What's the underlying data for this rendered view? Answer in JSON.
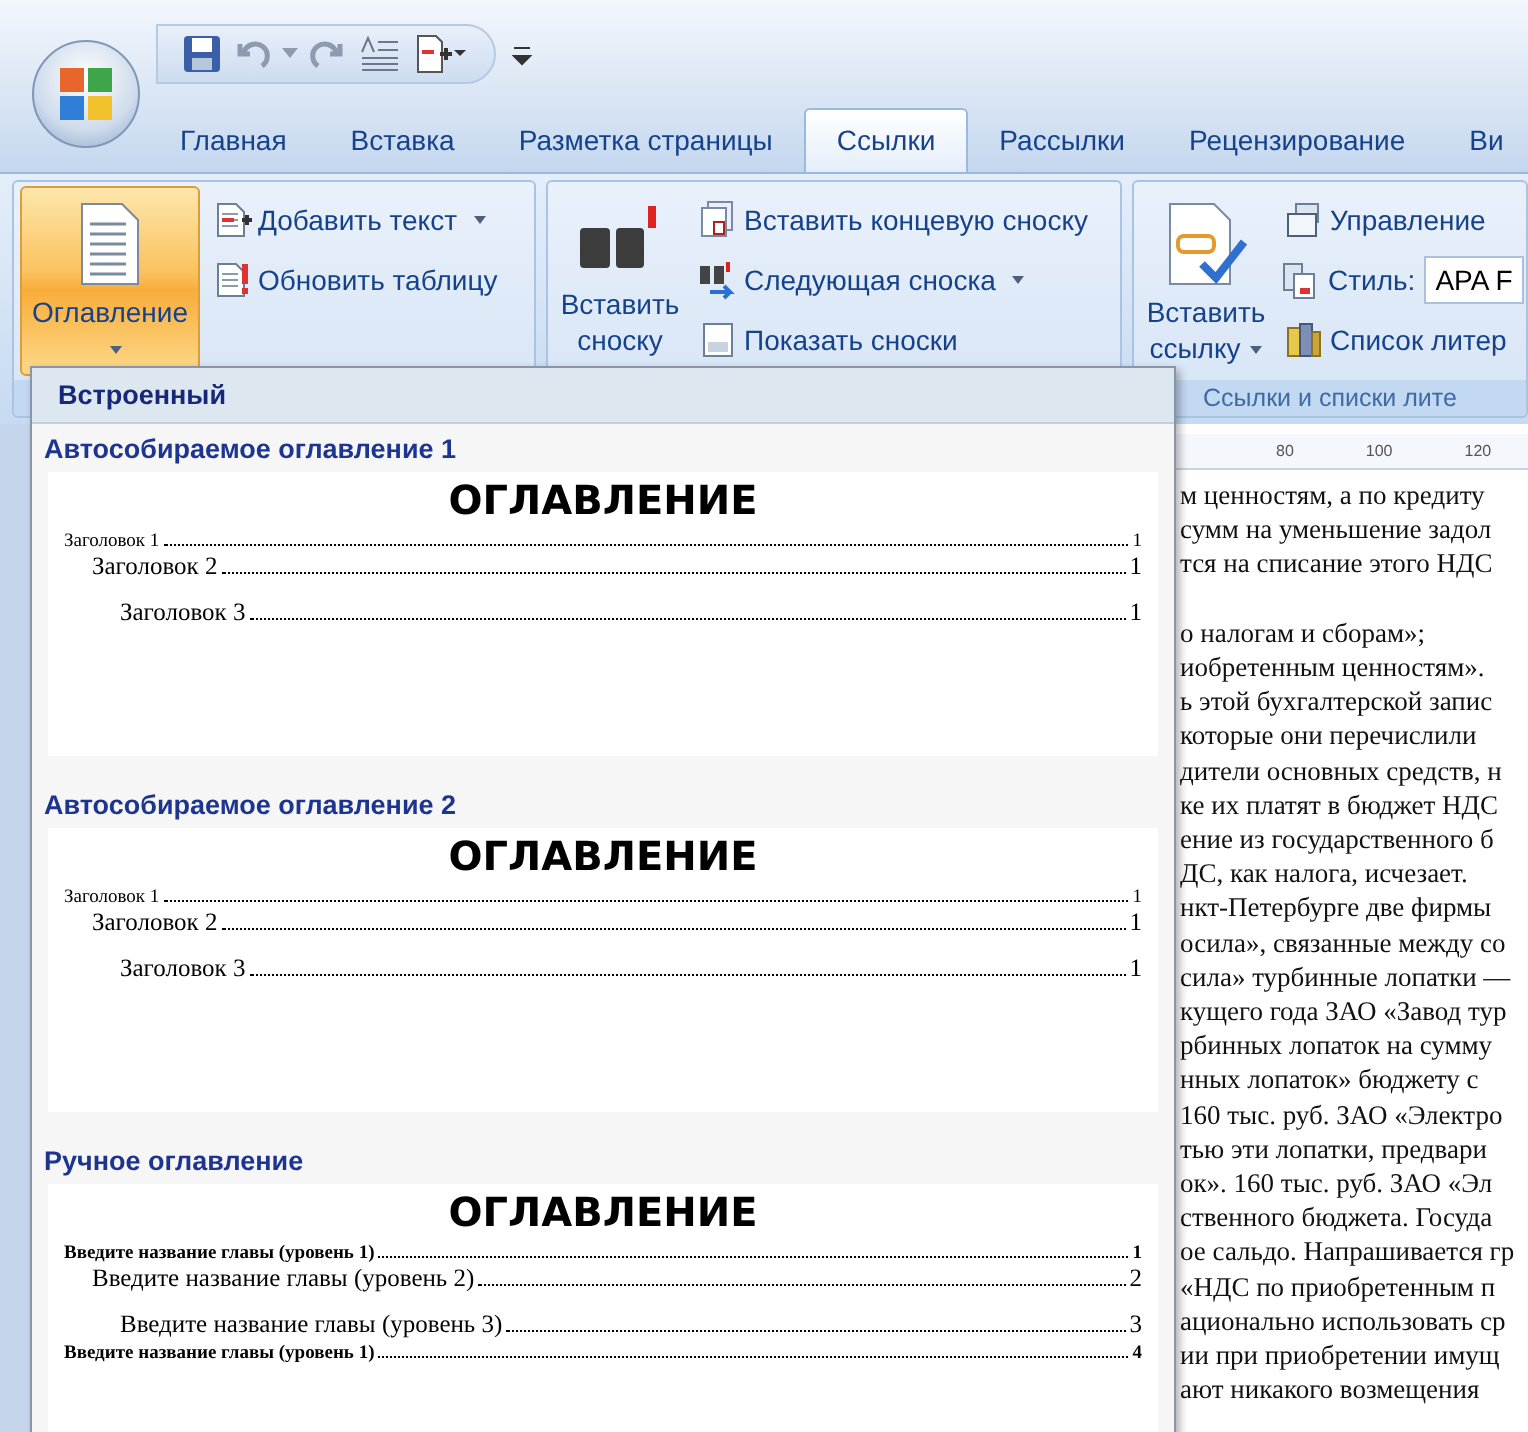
{
  "tabs": [
    {
      "label": "Главная",
      "selected": false
    },
    {
      "label": "Вставка",
      "selected": false
    },
    {
      "label": "Разметка страницы",
      "selected": false
    },
    {
      "label": "Ссылки",
      "selected": true
    },
    {
      "label": "Рассылки",
      "selected": false
    },
    {
      "label": "Рецензирование",
      "selected": false
    },
    {
      "label": "Ви",
      "selected": false
    }
  ],
  "ribbon": {
    "groups": [
      {
        "kind": "toc",
        "button": {
          "label": "Оглавление",
          "pressed": true,
          "dropdown": true
        },
        "commands": [
          {
            "kind": "command",
            "label": "Добавить текст",
            "dropdown": true
          },
          {
            "kind": "command",
            "label": "Обновить таблицу",
            "dropdown": false
          }
        ]
      },
      {
        "kind": "footnotes",
        "button": {
          "label": "Вставить сноску",
          "pressed": false,
          "dropdown": false
        },
        "commands": [
          {
            "kind": "command",
            "label": "Вставить концевую сноску",
            "dropdown": false
          },
          {
            "kind": "command",
            "label": "Следующая сноска",
            "dropdown": true
          },
          {
            "kind": "command",
            "label": "Показать сноски",
            "dropdown": false
          }
        ]
      },
      {
        "kind": "citations",
        "button": {
          "label": "Вставить ссылку",
          "pressed": false,
          "dropdown": true
        },
        "commands": [
          {
            "kind": "command",
            "label": "Управление",
            "dropdown": false
          },
          {
            "kind": "style",
            "label": "Стиль:",
            "value": "APA F"
          },
          {
            "kind": "command",
            "label": "Список литер",
            "dropdown": false
          }
        ],
        "label": "Ссылки и списки лите"
      }
    ]
  },
  "toc_gallery": {
    "header": "Встроенный",
    "sections": [
      {
        "kind": "auto",
        "title": "Автособираемое оглавление 1",
        "heading": "ОГЛАВЛЕНИЕ",
        "entries": [
          {
            "text": "Заголовок 1",
            "page": "1",
            "children": [
              {
                "text": "Заголовок 2",
                "page": "1",
                "children": [
                  {
                    "text": "Заголовок 3",
                    "page": "1"
                  }
                ]
              }
            ]
          }
        ]
      },
      {
        "kind": "auto",
        "title": "Автособираемое оглавление 2",
        "heading": "ОГЛАВЛЕНИЕ",
        "entries": [
          {
            "text": "Заголовок 1",
            "page": "1",
            "children": [
              {
                "text": "Заголовок 2",
                "page": "1",
                "children": [
                  {
                    "text": "Заголовок 3",
                    "page": "1"
                  }
                ]
              }
            ]
          }
        ]
      },
      {
        "kind": "manual",
        "title": "Ручное оглавление",
        "heading": "ОГЛАВЛЕНИЕ",
        "entries": [
          {
            "text": "Введите название главы (уровень 1)",
            "page": "1",
            "children": [
              {
                "text": "Введите название главы (уровень 2)",
                "page": "2",
                "children": [
                  {
                    "text": "Введите название главы (уровень 3)",
                    "page": "3"
                  }
                ]
              }
            ]
          },
          {
            "text": "Введите название главы (уровень 1)",
            "page": "4"
          }
        ]
      }
    ]
  },
  "ruler": {
    "labels": [
      "80",
      "100",
      "120"
    ]
  },
  "document": {
    "paragraphs": [
      {
        "lines": [
          "м ценностям, а по кредиту",
          "сумм на уменьшение задол",
          "тся на списание этого НДС"
        ]
      },
      {
        "lines": [
          "о налогам и сборам»;",
          "иобретенным ценностям».",
          "ь этой бухгалтерской запис",
          "которые они перечислили",
          "дители основных средств, н",
          "ке их платят в бюджет НДС",
          "ение из государственного б",
          "ДС, как налога, исчезает.",
          "нкт-Петербурге две фирмы",
          "осила», связанные между со",
          "сила» турбинные лопатки —",
          "кущего года ЗАО «Завод тур",
          "рбинных лопаток на сумму",
          "нных лопаток» бюджету с",
          "160 тыс. руб. ЗАО «Электро",
          "тью эти лопатки, предвари",
          "ок». 160 тыс. руб. ЗАО «Эл",
          "ственного бюджета. Госуда",
          "ое сальдо. Напрашивается гр",
          "«НДС по приобретенным п",
          "ационально использовать ср",
          "ии при приобретении имущ",
          "ают никакого возмещения"
        ]
      }
    ]
  }
}
